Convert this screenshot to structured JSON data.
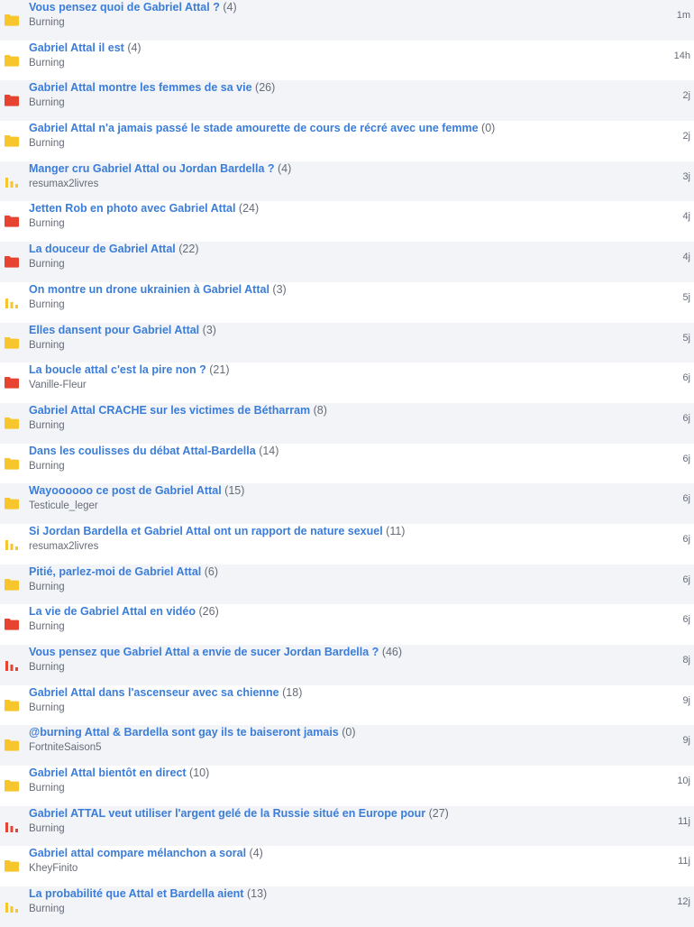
{
  "colors": {
    "folder_yellow": "#f6c62c",
    "folder_red": "#e64330",
    "poll_yellow": "#f6c62c",
    "poll_red": "#e64330",
    "title_link": "#3b7dd8",
    "meta_text": "#666c77",
    "row_alt": "#f2f4f8"
  },
  "topics": [
    {
      "title": "Vous pensez quoi de Gabriel Attal ?",
      "count": "(4)",
      "author": "Burning",
      "date": "1m",
      "icon": "folder-yellow-icon"
    },
    {
      "title": "Gabriel Attal il est",
      "count": "(4)",
      "author": "Burning",
      "date": "14h",
      "icon": "folder-yellow-icon"
    },
    {
      "title": "Gabriel Attal montre les femmes de sa vie",
      "count": "(26)",
      "author": "Burning",
      "date": "2j",
      "icon": "folder-red-icon"
    },
    {
      "title": "Gabriel Attal n'a jamais passé le stade amourette de cours de récré avec une femme",
      "count": "(0)",
      "author": "Burning",
      "date": "2j",
      "icon": "folder-yellow-icon"
    },
    {
      "title": "Manger cru Gabriel Attal ou Jordan Bardella ?",
      "count": "(4)",
      "author": "resumax2livres",
      "date": "3j",
      "icon": "poll-yellow-icon"
    },
    {
      "title": "Jetten Rob en photo avec Gabriel Attal",
      "count": "(24)",
      "author": "Burning",
      "date": "4j",
      "icon": "folder-red-icon"
    },
    {
      "title": "La douceur de Gabriel Attal",
      "count": "(22)",
      "author": "Burning",
      "date": "4j",
      "icon": "folder-red-icon"
    },
    {
      "title": "On montre un drone ukrainien à Gabriel Attal",
      "count": "(3)",
      "author": "Burning",
      "date": "5j",
      "icon": "poll-yellow-icon"
    },
    {
      "title": "Elles dansent pour Gabriel Attal",
      "count": "(3)",
      "author": "Burning",
      "date": "5j",
      "icon": "folder-yellow-icon"
    },
    {
      "title": "La boucle attal c'est la pire non ?",
      "count": "(21)",
      "author": "Vanille-Fleur",
      "date": "6j",
      "icon": "folder-red-icon"
    },
    {
      "title": "Gabriel Attal CRACHE sur les victimes de Bétharram",
      "count": "(8)",
      "author": "Burning",
      "date": "6j",
      "icon": "folder-yellow-icon"
    },
    {
      "title": "Dans les coulisses du débat Attal-Bardella",
      "count": "(14)",
      "author": "Burning",
      "date": "6j",
      "icon": "folder-yellow-icon"
    },
    {
      "title": "Wayoooooo ce post de Gabriel Attal",
      "count": "(15)",
      "author": "Testicule_leger",
      "date": "6j",
      "icon": "folder-yellow-icon"
    },
    {
      "title": "Si Jordan Bardella et Gabriel Attal ont un rapport de nature sexuel",
      "count": "(11)",
      "author": "resumax2livres",
      "date": "6j",
      "icon": "poll-yellow-icon"
    },
    {
      "title": "Pitié, parlez-moi de Gabriel Attal",
      "count": "(6)",
      "author": "Burning",
      "date": "6j",
      "icon": "folder-yellow-icon"
    },
    {
      "title": "La vie de Gabriel Attal en vidéo",
      "count": "(26)",
      "author": "Burning",
      "date": "6j",
      "icon": "folder-red-icon"
    },
    {
      "title": "Vous pensez que Gabriel Attal a envie de sucer Jordan Bardella ?",
      "count": "(46)",
      "author": "Burning",
      "date": "8j",
      "icon": "poll-red-icon"
    },
    {
      "title": "Gabriel Attal dans l'ascenseur avec sa chienne",
      "count": "(18)",
      "author": "Burning",
      "date": "9j",
      "icon": "folder-yellow-icon"
    },
    {
      "title": "@burning Attal & Bardella sont gay ils te baiseront jamais",
      "count": "(0)",
      "author": "FortniteSaison5",
      "date": "9j",
      "icon": "folder-yellow-icon"
    },
    {
      "title": "Gabriel Attal bientôt en direct",
      "count": "(10)",
      "author": "Burning",
      "date": "10j",
      "icon": "folder-yellow-icon"
    },
    {
      "title": "Gabriel ATTAL veut utiliser l'argent gelé de la Russie situé en Europe pour",
      "count": "(27)",
      "author": "Burning",
      "date": "11j",
      "icon": "poll-red-icon"
    },
    {
      "title": "Gabriel attal compare mélanchon a soral",
      "count": "(4)",
      "author": "KheyFinito",
      "date": "11j",
      "icon": "folder-yellow-icon"
    },
    {
      "title": "La probabilité que Attal et Bardella aient",
      "count": "(13)",
      "author": "Burning",
      "date": "12j",
      "icon": "poll-yellow-icon"
    }
  ]
}
